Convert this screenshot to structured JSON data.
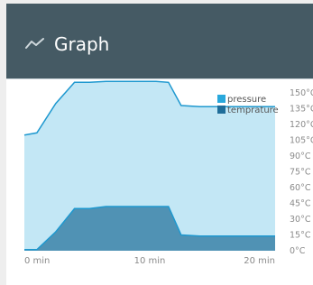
{
  "header": {
    "title": "Graph",
    "icon": "trend-line-icon"
  },
  "chart_data": {
    "type": "area",
    "x": [
      0,
      1,
      2.5,
      4,
      5.2,
      6.5,
      7.5,
      9,
      10.5,
      11.5,
      12.5,
      14,
      15.5,
      17,
      20
    ],
    "series": [
      {
        "name": "pressure",
        "color": "#29a8dc",
        "values": [
          110,
          112,
          140,
          160,
          160,
          161,
          161,
          161,
          161,
          160,
          138,
          137,
          137,
          137,
          137
        ]
      },
      {
        "name": "temprature",
        "color": "#1f6d99",
        "values": [
          1,
          1,
          18,
          40,
          40,
          42,
          42,
          42,
          42,
          42,
          15,
          14,
          14,
          14,
          14
        ]
      }
    ],
    "xticks": [
      {
        "value": 0,
        "label": "0 min"
      },
      {
        "value": 10,
        "label": "10 min"
      },
      {
        "value": 20,
        "label": "20 min"
      }
    ],
    "yticks": [
      {
        "value": 0,
        "label": "0°C"
      },
      {
        "value": 15,
        "label": "15°C"
      },
      {
        "value": 30,
        "label": "30°C"
      },
      {
        "value": 45,
        "label": "45°C"
      },
      {
        "value": 60,
        "label": "60°C"
      },
      {
        "value": 75,
        "label": "75°C"
      },
      {
        "value": 90,
        "label": "90°C"
      },
      {
        "value": 105,
        "label": "105°C"
      },
      {
        "value": 120,
        "label": "120°C"
      },
      {
        "value": 135,
        "label": "135°C"
      },
      {
        "value": 150,
        "label": "150°C"
      }
    ],
    "xlim": [
      0,
      20
    ],
    "ylim": [
      0,
      150
    ],
    "legend": "top-right",
    "grid": false
  }
}
